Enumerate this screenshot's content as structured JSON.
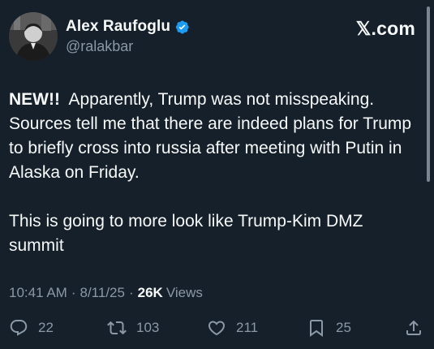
{
  "author": {
    "display_name": "Alex Raufoglu",
    "handle": "@ralakbar",
    "verified": true
  },
  "brand": "𝕏.com",
  "tweet": {
    "lead": "NEW!!",
    "paragraph1": "Apparently, Trump was not misspeaking. Sources tell me that there are indeed plans for Trump to briefly cross into russia after meeting with Putin in Alaska on Friday.",
    "paragraph2": "This is going to more look like Trump-Kim DMZ summit"
  },
  "meta": {
    "time": "10:41 AM",
    "separator": "·",
    "date": "8/11/25",
    "views_count": "26K",
    "views_label": "Views"
  },
  "actions": {
    "replies": "22",
    "reposts": "103",
    "likes": "211",
    "bookmarks": "25"
  },
  "colors": {
    "background": "#15202b",
    "text": "#f7f9f9",
    "secondary": "#8b98a5",
    "verified": "#1d9bf0"
  },
  "icons": {
    "reply": "speech-bubble-icon",
    "repost": "repost-arrows-icon",
    "like": "heart-icon",
    "bookmark": "bookmark-icon",
    "share": "share-upload-icon",
    "verified": "verified-badge-icon"
  }
}
